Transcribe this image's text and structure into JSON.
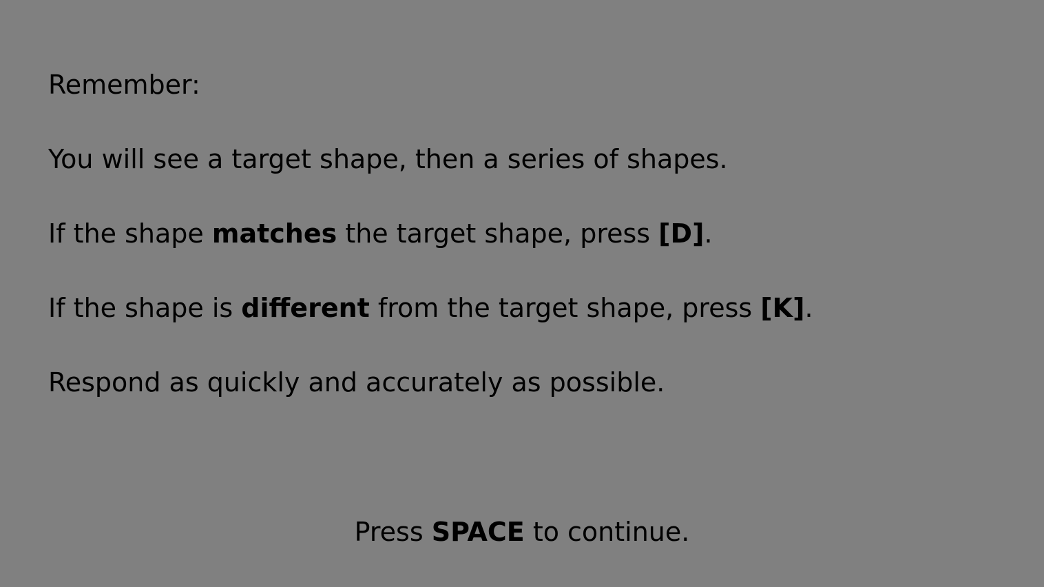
{
  "colors": {
    "background": "#808080",
    "text": "#000000"
  },
  "instructions": {
    "heading": "Remember:",
    "line1": "You will see a target shape, then a series of shapes.",
    "line2": {
      "pre": "If the shape ",
      "bold": "matches",
      "mid": " the target shape, press ",
      "key": "[D]",
      "post": "."
    },
    "line3": {
      "pre": "If the shape is ",
      "bold": "different",
      "mid": " from the target shape, press ",
      "key": "[K]",
      "post": "."
    },
    "line4": "Respond as quickly and accurately as possible."
  },
  "continue_prompt": {
    "pre": "Press ",
    "key": "SPACE",
    "post": " to continue."
  }
}
